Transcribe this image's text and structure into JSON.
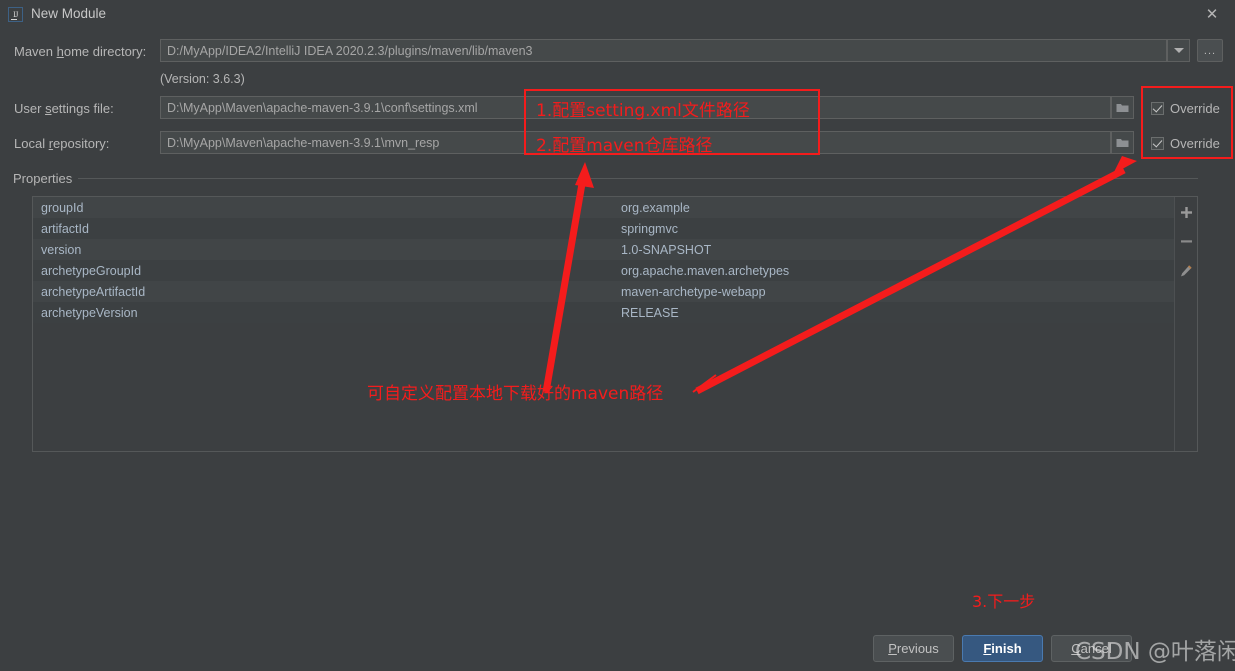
{
  "window": {
    "title": "New Module",
    "app_icon": "intellij-idea-icon",
    "close_icon": "close-icon"
  },
  "form": {
    "maven_home": {
      "label": "Maven ",
      "label_accel": "h",
      "label_rest": "ome directory:",
      "value": "D:/MyApp/IDEA2/IntelliJ IDEA 2020.2.3/plugins/maven/lib/maven3",
      "dropdown_icon": "chevron-down-icon",
      "browse_label": "..."
    },
    "version_note": "(Version: 3.6.3)",
    "user_settings": {
      "label": "User ",
      "label_accel": "s",
      "label_rest": "ettings file:",
      "value": "D:\\MyApp\\Maven\\apache-maven-3.9.1\\conf\\settings.xml",
      "folder_icon": "folder-icon",
      "override_label": "Override",
      "override_checked": true
    },
    "local_repository": {
      "label": "Local ",
      "label_accel": "r",
      "label_rest": "epository:",
      "value": "D:\\MyApp\\Maven\\apache-maven-3.9.1\\mvn_resp",
      "folder_icon": "folder-icon",
      "override_label": "Override",
      "override_checked": true
    }
  },
  "properties": {
    "group_label": "Properties",
    "rows": [
      {
        "key": "groupId",
        "value": "org.example"
      },
      {
        "key": "artifactId",
        "value": "springmvc"
      },
      {
        "key": "version",
        "value": "1.0-SNAPSHOT"
      },
      {
        "key": "archetypeGroupId",
        "value": "org.apache.maven.archetypes"
      },
      {
        "key": "archetypeArtifactId",
        "value": "maven-archetype-webapp"
      },
      {
        "key": "archetypeVersion",
        "value": "RELEASE"
      }
    ],
    "side_actions": [
      {
        "name": "add-property-button",
        "glyph": "+"
      },
      {
        "name": "remove-property-button",
        "glyph": "–"
      },
      {
        "name": "edit-property-button",
        "glyph": "✎"
      }
    ]
  },
  "footer": {
    "previous": {
      "pre": "",
      "accel": "P",
      "rest": "revious"
    },
    "finish": {
      "pre": "",
      "accel": "F",
      "rest": "inish"
    },
    "cancel": {
      "pre": "",
      "accel": "C",
      "rest": "ancel"
    }
  },
  "annotations": {
    "settings_note": "1.配置setting.xml文件路径",
    "repository_note": "2.配置maven仓库路径",
    "bottom_note": "可自定义配置本地下载好的maven路径",
    "next_step_note": "3.下一步",
    "color": "#f41c1c"
  },
  "watermark": {
    "text": "CSDN @叶落闲庭"
  },
  "colors": {
    "dialog_bg": "#3c3f41",
    "field_bg": "#45494a",
    "accent_button": "#365880",
    "annotation_red": "#f41c1c",
    "text": "#b6b6b6"
  }
}
